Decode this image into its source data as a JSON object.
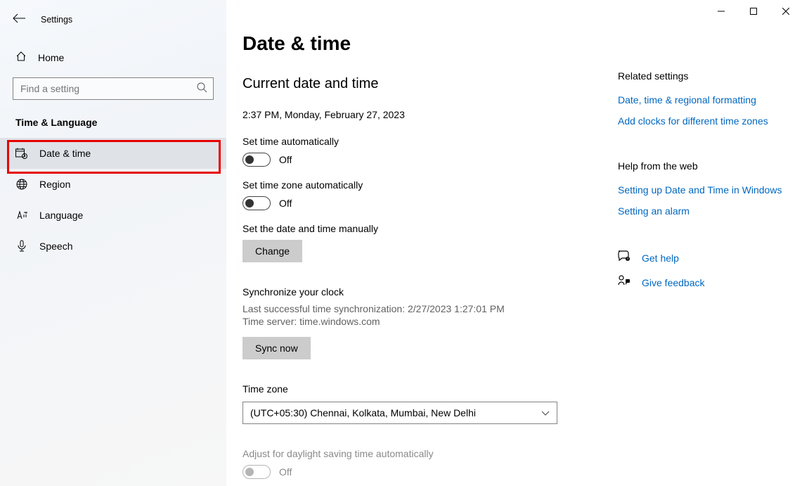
{
  "window": {
    "title": "Settings"
  },
  "sidebar": {
    "home": "Home",
    "search_placeholder": "Find a setting",
    "category": "Time & Language",
    "items": [
      {
        "label": "Date & time"
      },
      {
        "label": "Region"
      },
      {
        "label": "Language"
      },
      {
        "label": "Speech"
      }
    ]
  },
  "main": {
    "title": "Date & time",
    "subtitle": "Current date and time",
    "current": "2:37 PM, Monday, February 27, 2023",
    "auto_time": {
      "label": "Set time automatically",
      "state": "Off"
    },
    "auto_tz": {
      "label": "Set time zone automatically",
      "state": "Off"
    },
    "manual": {
      "label": "Set the date and time manually",
      "button": "Change"
    },
    "sync": {
      "heading": "Synchronize your clock",
      "last": "Last successful time synchronization: 2/27/2023 1:27:01 PM",
      "server": "Time server: time.windows.com",
      "button": "Sync now"
    },
    "tz": {
      "label": "Time zone",
      "value": "(UTC+05:30) Chennai, Kolkata, Mumbai, New Delhi"
    },
    "dst": {
      "label": "Adjust for daylight saving time automatically",
      "state": "Off"
    }
  },
  "right": {
    "related_head": "Related settings",
    "related": [
      "Date, time & regional formatting",
      "Add clocks for different time zones"
    ],
    "help_head": "Help from the web",
    "help": [
      "Setting up Date and Time in Windows",
      "Setting an alarm"
    ],
    "gethelp": "Get help",
    "feedback": "Give feedback"
  }
}
